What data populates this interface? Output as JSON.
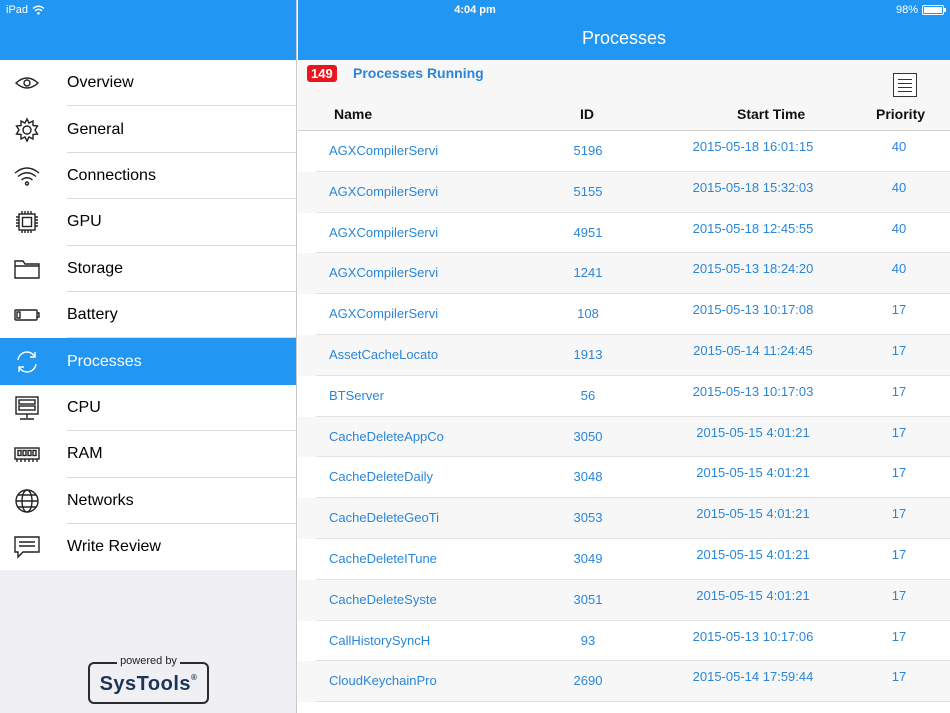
{
  "status_bar": {
    "carrier": "iPad",
    "time": "4:04 pm",
    "battery": "98%",
    "battery_level": 0.98
  },
  "sidebar": {
    "items": [
      {
        "label": "Overview",
        "icon": "eye-icon"
      },
      {
        "label": "General",
        "icon": "gear-icon"
      },
      {
        "label": "Connections",
        "icon": "wifi-icon"
      },
      {
        "label": "GPU",
        "icon": "chip-icon"
      },
      {
        "label": "Storage",
        "icon": "folder-icon"
      },
      {
        "label": "Battery",
        "icon": "battery-icon"
      },
      {
        "label": "Processes",
        "icon": "refresh-icon",
        "active": true
      },
      {
        "label": "CPU",
        "icon": "cpu-icon"
      },
      {
        "label": "RAM",
        "icon": "ram-icon"
      },
      {
        "label": "Networks",
        "icon": "globe-icon"
      },
      {
        "label": "Write Review",
        "icon": "comment-icon"
      }
    ],
    "powered_by": "powered by",
    "brand": "SysTools",
    "brand_mark": "®"
  },
  "main": {
    "title": "Processes",
    "count": "149",
    "count_label": "Processes Running",
    "columns": {
      "name": "Name",
      "id": "ID",
      "start_time": "Start Time",
      "priority": "Priority"
    },
    "rows": [
      {
        "name": "AGXCompilerServi",
        "id": "5196",
        "start_time": "2015-05-18 16:01:15",
        "priority": "40"
      },
      {
        "name": "AGXCompilerServi",
        "id": "5155",
        "start_time": "2015-05-18 15:32:03",
        "priority": "40"
      },
      {
        "name": "AGXCompilerServi",
        "id": "4951",
        "start_time": "2015-05-18 12:45:55",
        "priority": "40"
      },
      {
        "name": "AGXCompilerServi",
        "id": "1241",
        "start_time": "2015-05-13 18:24:20",
        "priority": "40"
      },
      {
        "name": "AGXCompilerServi",
        "id": "108",
        "start_time": "2015-05-13 10:17:08",
        "priority": "17"
      },
      {
        "name": "AssetCacheLocato",
        "id": "1913",
        "start_time": "2015-05-14 11:24:45",
        "priority": "17"
      },
      {
        "name": "BTServer",
        "id": "56",
        "start_time": "2015-05-13 10:17:03",
        "priority": "17"
      },
      {
        "name": "CacheDeleteAppCo",
        "id": "3050",
        "start_time": "2015-05-15 4:01:21",
        "priority": "17"
      },
      {
        "name": "CacheDeleteDaily",
        "id": "3048",
        "start_time": "2015-05-15 4:01:21",
        "priority": "17"
      },
      {
        "name": "CacheDeleteGeoTi",
        "id": "3053",
        "start_time": "2015-05-15 4:01:21",
        "priority": "17"
      },
      {
        "name": "CacheDeleteITune",
        "id": "3049",
        "start_time": "2015-05-15 4:01:21",
        "priority": "17"
      },
      {
        "name": "CacheDeleteSyste",
        "id": "3051",
        "start_time": "2015-05-15 4:01:21",
        "priority": "17"
      },
      {
        "name": "CallHistorySyncH",
        "id": "93",
        "start_time": "2015-05-13 10:17:06",
        "priority": "17"
      },
      {
        "name": "CloudKeychainPro",
        "id": "2690",
        "start_time": "2015-05-14 17:59:44",
        "priority": "17"
      }
    ]
  },
  "colors": {
    "accent": "#2196f3",
    "link": "#2a86d8",
    "badge": "#e8141e"
  }
}
